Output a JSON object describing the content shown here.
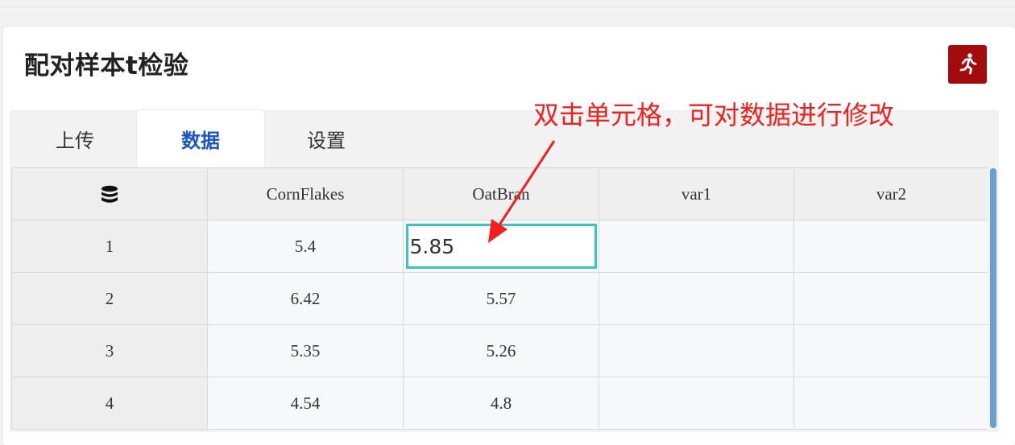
{
  "page": {
    "title": "配对样本t检验"
  },
  "toolbar": {
    "run_icon": "running-person-icon",
    "run_color": "#a30c0c"
  },
  "tabs": [
    {
      "label": "上传",
      "active": false
    },
    {
      "label": "数据",
      "active": true
    },
    {
      "label": "设置",
      "active": false
    }
  ],
  "grid": {
    "corner_icon": "database-icon",
    "columns": [
      "CornFlakes",
      "OatBran",
      "var1",
      "var2"
    ],
    "rows": [
      {
        "index": "1",
        "cells": [
          "5.4",
          "5.85",
          "",
          ""
        ]
      },
      {
        "index": "2",
        "cells": [
          "6.42",
          "5.57",
          "",
          ""
        ]
      },
      {
        "index": "3",
        "cells": [
          "5.35",
          "5.26",
          "",
          ""
        ]
      },
      {
        "index": "4",
        "cells": [
          "4.54",
          "4.8",
          "",
          ""
        ]
      }
    ],
    "editing_cell": {
      "row": 1,
      "column": "OatBran",
      "value": "5.85"
    }
  },
  "annotation": {
    "text": "双击单元格，可对数据进行修改",
    "color": "#f0201e"
  }
}
